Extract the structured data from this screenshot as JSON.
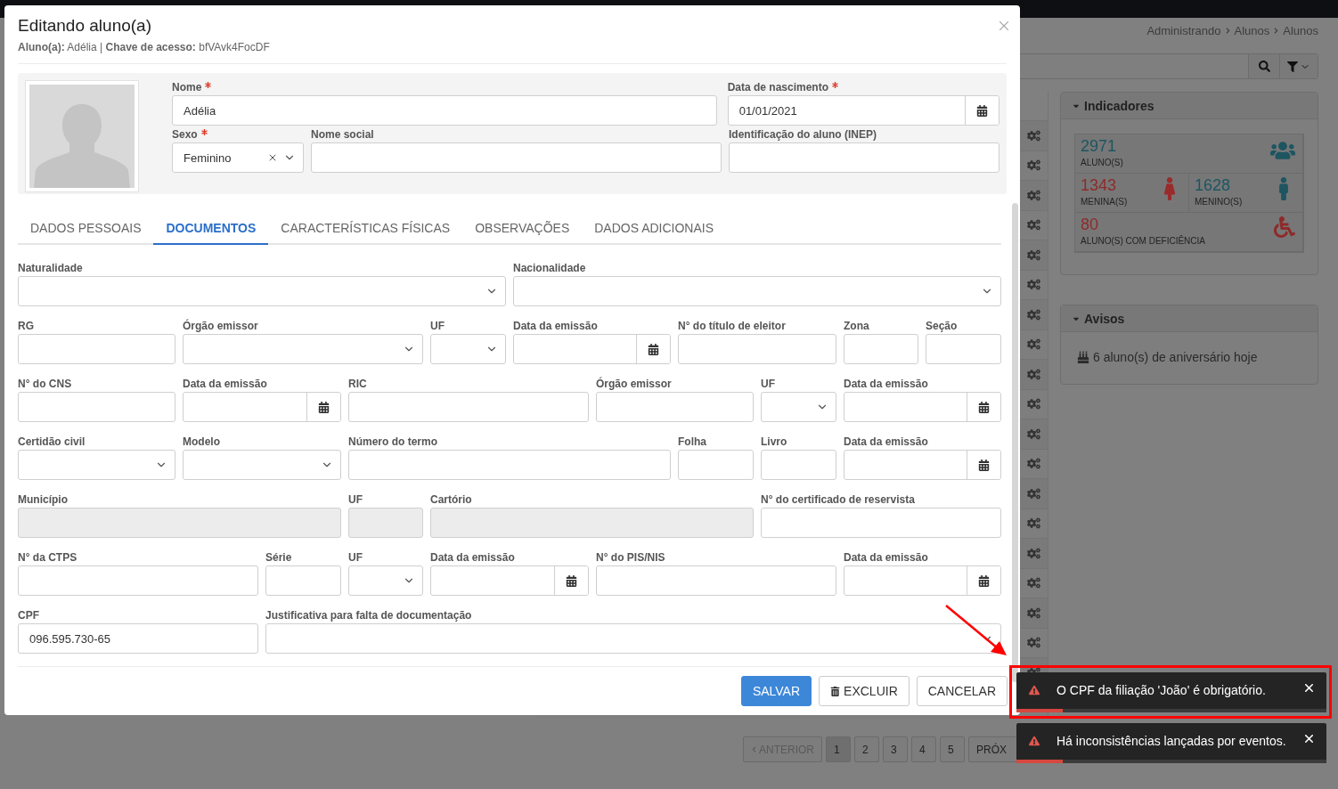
{
  "breadcrumb": [
    "Administrando",
    "Alunos",
    "Alunos"
  ],
  "modal": {
    "title": "Editando aluno(a)",
    "subtitle": "**Aluno(a):** Adélia | **Chave de acesso:** bfVAvk4FocDF",
    "profile_rows": [
      [
        {
          "label": "Nome",
          "required": true,
          "kind": "text",
          "value": "Adélia"
        },
        {
          "label": "Data de nascimento",
          "required": true,
          "kind": "date",
          "value": "01/01/2021"
        }
      ],
      [
        {
          "label": "Sexo",
          "required": true,
          "kind": "select",
          "value": "Feminino"
        },
        {
          "label": "Nome social",
          "required": false,
          "kind": "text"
        },
        {
          "label": "Identificação do aluno (INEP)",
          "required": false,
          "kind": "text"
        }
      ]
    ],
    "tabs": [
      {
        "label": "DADOS PESSOAIS",
        "selected": false
      },
      {
        "label": "DOCUMENTOS",
        "selected": true
      },
      {
        "label": "CARACTERÍSTICAS FÍSICAS",
        "selected": false
      },
      {
        "label": "OBSERVAÇÕES",
        "selected": false
      },
      {
        "label": "DADOS ADICIONAIS",
        "selected": false
      }
    ],
    "document_rows": [
      [
        {
          "label": "Naturalidade",
          "kind": "select"
        },
        {
          "label": "Nacionalidade",
          "kind": "select"
        }
      ],
      [
        {
          "label": "RG",
          "kind": "text"
        },
        {
          "label": "Órgão emissor",
          "kind": "select"
        },
        {
          "label": "UF",
          "kind": "select"
        },
        {
          "label": "Data da emissão",
          "kind": "date"
        },
        {
          "label": "N° do título de eleitor",
          "kind": "text"
        },
        {
          "label": "Zona",
          "kind": "text"
        },
        {
          "label": "Seção",
          "kind": "text"
        }
      ],
      [
        {
          "label": "N° do CNS",
          "kind": "text"
        },
        {
          "label": "Data da emissão",
          "kind": "date"
        },
        {
          "label": "RIC",
          "kind": "text"
        },
        {
          "label": "Órgão emissor",
          "kind": "text"
        },
        {
          "label": "UF",
          "kind": "select"
        },
        {
          "label": "Data da emissão",
          "kind": "date"
        }
      ],
      [
        {
          "label": "Certidão civil",
          "kind": "select"
        },
        {
          "label": "Modelo",
          "kind": "select"
        },
        {
          "label": "Número do termo",
          "kind": "text"
        },
        {
          "label": "Folha",
          "kind": "text"
        },
        {
          "label": "Livro",
          "kind": "text"
        },
        {
          "label": "Data da emissão",
          "kind": "date"
        }
      ],
      [
        {
          "label": "Município",
          "kind": "locked"
        },
        {
          "label": "UF",
          "kind": "locked"
        },
        {
          "label": "Cartório",
          "kind": "locked"
        },
        {
          "label": "N° do certificado de reservista",
          "kind": "text"
        }
      ],
      [
        {
          "label": "N° da CTPS",
          "kind": "text"
        },
        {
          "label": "Série",
          "kind": "text"
        },
        {
          "label": "UF",
          "kind": "select"
        },
        {
          "label": "Data da emissão",
          "kind": "date"
        },
        {
          "label": "N° do PIS/NIS",
          "kind": "text"
        },
        {
          "label": "Data da emissão",
          "kind": "date"
        }
      ],
      [
        {
          "label": "CPF",
          "kind": "text",
          "value": "096.595.730-65"
        },
        {
          "label": "Justificativa para falta de documentação",
          "kind": "select"
        }
      ]
    ],
    "buttons": [
      {
        "label": "SALVAR",
        "kind": "primary"
      },
      {
        "label": "EXCLUIR",
        "kind": "delete"
      },
      {
        "label": "CANCELAR",
        "kind": "default"
      }
    ]
  },
  "indicators": {
    "title": "Indicadores",
    "stats": [
      {
        "value": "2971",
        "label": "ALUNO(S)",
        "kind": "total"
      },
      {
        "value": "1343",
        "label": "MENINA(S)",
        "kind": "girls"
      },
      {
        "value": "1628",
        "label": "MENINO(S)",
        "kind": "boys"
      },
      {
        "value": "80",
        "label": "ALUNO(S) COM DEFICIÊNCIA",
        "kind": "disability"
      }
    ]
  },
  "notices": {
    "title": "Avisos",
    "items": [
      {
        "text": "6 aluno(s) de aniversário hoje"
      }
    ]
  },
  "pagination": {
    "previous": "ANTERIOR",
    "pages": [
      {
        "label": "1",
        "selected": true
      },
      {
        "label": "2",
        "selected": false
      },
      {
        "label": "3",
        "selected": false
      },
      {
        "label": "4",
        "selected": false
      },
      {
        "label": "5",
        "selected": false
      }
    ],
    "next": "PRÓX"
  },
  "toasts": [
    {
      "message": "O CPF da filiação 'João' é obrigatório.",
      "level": 0.15,
      "highlighted": true
    },
    {
      "message": "Há inconsistências lançadas por eventos.",
      "level": 0.15,
      "highlighted": false
    }
  ]
}
